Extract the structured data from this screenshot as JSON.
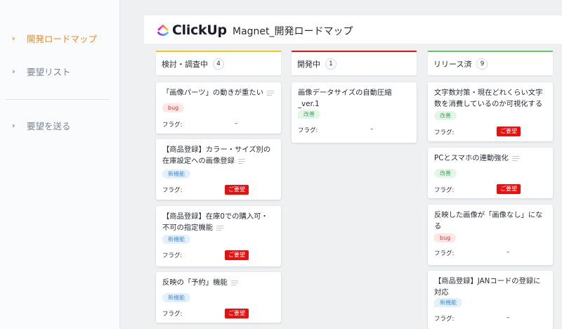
{
  "sidebar": {
    "items": [
      {
        "label": "開発ロードマップ",
        "active": true
      },
      {
        "label": "要望リスト",
        "active": false
      },
      {
        "label": "要望を送る",
        "active": false
      }
    ],
    "chevron": "›"
  },
  "header": {
    "logo_text": "ClickUp",
    "board_title": "Magnet_開発ロードマップ"
  },
  "flag_label": "フラグ:",
  "columns": [
    {
      "name": "検討・調査中",
      "count": "4",
      "accent": "#f5c518",
      "cards": [
        {
          "title": "「画像パーツ」の動きが重たい",
          "tag": "bug",
          "flag": "–"
        },
        {
          "title": "【商品登録】カラー・サイズ別の在庫設定への画像登録",
          "tag": "新機能",
          "flag": "ご要望"
        },
        {
          "title": "【商品登録】在庫0での購入可・不可の指定機能",
          "tag": "新機能",
          "flag": "ご要望"
        },
        {
          "title": "反映の「予約」機能",
          "tag": "新機能",
          "flag": "ご要望"
        }
      ]
    },
    {
      "name": "開発中",
      "count": "1",
      "accent": "#e8110f",
      "cards": [
        {
          "title": "画像データサイズの自動圧縮_ver.1",
          "tag": "改善",
          "flag": "–"
        }
      ]
    },
    {
      "name": "リリース済",
      "count": "9",
      "accent": "#5ec95e",
      "cards": [
        {
          "title": "文字数対策・現在どれくらい文字数を消費しているのか可視化する",
          "tag": "改善",
          "flag": "ご要望"
        },
        {
          "title": "PCとスマホの連動強化",
          "tag": "改善",
          "flag": "ご要望"
        },
        {
          "title": "反映した画像が「画像なし」になる",
          "tag": "bug",
          "flag": "–"
        },
        {
          "title": "【商品登録】JANコードの登録に対応",
          "tag": "新機能",
          "flag": "–"
        }
      ]
    }
  ]
}
